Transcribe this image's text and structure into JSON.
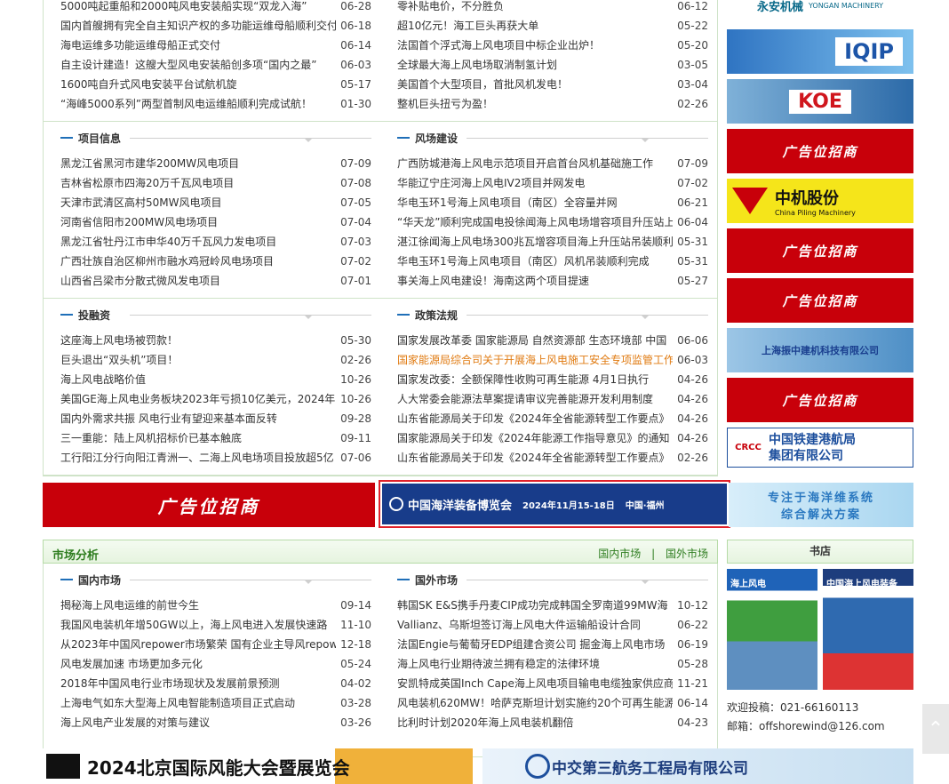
{
  "top_section": {
    "left": [
      {
        "title": "5000吨起重船和2000吨风电安装船实现“双龙入海”",
        "date": "06-28"
      },
      {
        "title": "国内首艘拥有完全自主知识产权的多功能运维母船顺利交付",
        "date": "06-18"
      },
      {
        "title": "海电运维多功能运维母船正式交付",
        "date": "06-14"
      },
      {
        "title": "自主设计建造！这艘大型风电安装船创多项“国内之最”",
        "date": "06-03"
      },
      {
        "title": "1600吨自升式风电安装平台试航机旋",
        "date": "05-17"
      },
      {
        "title": "“海峰5000系列”两型首制风电运维船顺利完成试航！",
        "date": "01-30"
      }
    ],
    "right": [
      {
        "title": "零补贴电价，不分胜负",
        "date": "06-12"
      },
      {
        "title": "超10亿元！海工巨头再获大单",
        "date": "05-22"
      },
      {
        "title": "法国首个浮式海上风电项目中标企业出炉！",
        "date": "05-20"
      },
      {
        "title": "全球最大海上风电场取消制氢计划",
        "date": "03-05"
      },
      {
        "title": "美国首个大型项目，首批风机发电！",
        "date": "03-04"
      },
      {
        "title": "整机巨头扭亏为盈！",
        "date": "02-26"
      }
    ]
  },
  "project_info": {
    "title": "项目信息",
    "items": [
      {
        "title": "黑龙江省黑河市建华200MW风电项目",
        "date": "07-09"
      },
      {
        "title": "吉林省松原市四海20万千瓦风电项目",
        "date": "07-08"
      },
      {
        "title": "天津市武清区高村50MW风电项目",
        "date": "07-05"
      },
      {
        "title": "河南省信阳市200MW风电场项目",
        "date": "07-04"
      },
      {
        "title": "黑龙江省牡丹江市申华40万千瓦风力发电项目",
        "date": "07-03"
      },
      {
        "title": "广西壮族自治区柳州市融水鸡冠岭风电场项目",
        "date": "07-02"
      },
      {
        "title": "山西省吕梁市分散式微风发电项目",
        "date": "07-01"
      }
    ]
  },
  "wind_farm": {
    "title": "风场建设",
    "items": [
      {
        "title": "广西防城港海上风电示范项目开启首台风机基础施工作",
        "date": "07-09"
      },
      {
        "title": "华能辽宁庄河海上风电IV2项目并网发电",
        "date": "07-02"
      },
      {
        "title": "华电玉环1号海上风电项目（南区）全容量并网",
        "date": "06-21"
      },
      {
        "title": "“华天龙”顺利完成国电投徐闻海上风电场增容项目升压站上",
        "date": "06-04"
      },
      {
        "title": "湛江徐闻海上风电场300兆瓦增容项目海上升压站吊装顺利",
        "date": "05-31"
      },
      {
        "title": "华电玉环1号海上风电项目（南区）风机吊装顺利完成",
        "date": "05-31"
      },
      {
        "title": "事关海上风电建设！海南这两个项目提速",
        "date": "05-27"
      }
    ]
  },
  "investment": {
    "title": "投融资",
    "items": [
      {
        "title": "这座海上风电场被罚款！",
        "date": "05-30"
      },
      {
        "title": "巨头退出“双头机”项目！",
        "date": "02-26"
      },
      {
        "title": "海上风电战略价值",
        "date": "10-26"
      },
      {
        "title": "美国GE海上风电业务板块2023年亏损10亿美元，2024年",
        "date": "10-26"
      },
      {
        "title": "国内外需求共振 风电行业有望迎来基本面反转",
        "date": "09-28"
      },
      {
        "title": "三一重能：陆上风机招标价已基本触底",
        "date": "09-11"
      },
      {
        "title": "工行阳江分行向阳江青洲一、二海上风电场项目投放超5亿",
        "date": "07-06"
      }
    ]
  },
  "policy": {
    "title": "政策法规",
    "items": [
      {
        "title": "国家发展改革委 国家能源局 自然资源部 生态环境部 中国",
        "date": "06-06",
        "highlight": false
      },
      {
        "title": "国家能源局综合司关于开展海上风电施工安全专项监管工作",
        "date": "06-03",
        "highlight": true
      },
      {
        "title": "国家发改委：全额保障性收购可再生能源 4月1日执行",
        "date": "04-26",
        "highlight": false
      },
      {
        "title": "人大常委会能源法草案提请审议完善能源开发利用制度",
        "date": "04-26",
        "highlight": false
      },
      {
        "title": "山东省能源局关于印发《2024年全省能源转型工作要点》",
        "date": "04-26",
        "highlight": false
      },
      {
        "title": "国家能源局关于印发《2024年能源工作指导意见》的通知",
        "date": "04-26",
        "highlight": false
      },
      {
        "title": "山东省能源局关于印发《2024年全省能源转型工作要点》",
        "date": "02-26",
        "highlight": false
      }
    ]
  },
  "banners": {
    "ad_wide": "广告位招商",
    "expo_name": "中国海洋装备博览会",
    "expo_date": "2024年11月15-18日",
    "expo_loc": "中国·福州",
    "ocean_ad_line1": "专注于海洋维系统",
    "ocean_ad_line2": "综合解决方案"
  },
  "market": {
    "title": "市场分析",
    "link_domestic": "国内市场",
    "sep": "|",
    "link_foreign": "国外市场",
    "domestic": {
      "title": "国内市场",
      "items": [
        {
          "title": "揭秘海上风电运维的前世今生",
          "date": "09-14"
        },
        {
          "title": "我国风电装机年增50GW以上，海上风电进入发展快速路",
          "date": "11-10"
        },
        {
          "title": "从2023年中国风repower市场繁荣 国有企业主导风repow",
          "date": "12-18"
        },
        {
          "title": "风电发展加速 市场更加多元化",
          "date": "05-24"
        },
        {
          "title": "2018年中国风电行业市场现状及发展前景预测",
          "date": "04-02"
        },
        {
          "title": "上海电气如东大型海上风电智能制造项目正式启动",
          "date": "03-28"
        },
        {
          "title": "海上风电产业发展的对策与建议",
          "date": "03-26"
        }
      ]
    },
    "foreign": {
      "title": "国外市场",
      "items": [
        {
          "title": "韩国SK E&S携手丹麦CIP成功完成韩国全罗南道99MW海",
          "date": "10-12"
        },
        {
          "title": "Vallianz、乌斯坦签订海上风电大件运输船设计合同",
          "date": "06-22"
        },
        {
          "title": "法国Engie与葡萄牙EDP组建合资公司 掘金海上风电市场",
          "date": "06-19"
        },
        {
          "title": "海上风电行业期待波兰拥有稳定的法律环境",
          "date": "05-28"
        },
        {
          "title": "安凯特成英国Inch Cape海上风电项目输电电缆独家供应商",
          "date": "11-21"
        },
        {
          "title": "风电装机620MW！哈萨克斯坦计划实施约20个可再生能源",
          "date": "06-14"
        },
        {
          "title": "比利时计划2020年海上风电装机翻倍",
          "date": "04-23"
        }
      ]
    }
  },
  "sidebar": {
    "ad_red_label": "广告位招商",
    "yongan_name": "永安机械",
    "yongan_en": "YONGAN MACHINERY",
    "iqip_text": "IQIP",
    "koe_text": "KOE",
    "piling_name": "中机股份",
    "piling_en": "China Piling Machinery",
    "zhenzhong_name": "上海振中建机科技有限公司",
    "rail_logo": "CRCC",
    "rail_name_1": "中国铁建港航局",
    "rail_name_2": "集团有限公司",
    "bookstore": "书店",
    "book1_label": "海上风电",
    "book2_label": "中国海上风电装备",
    "contact_phone_label": "欢迎投稿：",
    "contact_phone": "021-66160113",
    "contact_email_label": "邮箱：",
    "contact_email": "offshorewind@126.com"
  },
  "footer": {
    "left_ad": "2024北京国际风能大会暨展览会",
    "right_ad": "中交第三航务工程局有限公司"
  },
  "colors": {
    "accent_blue": "#1f6fb8",
    "green_header": "#2e7d1f",
    "ad_red": "#c8000a",
    "highlight_orange": "#e07a10",
    "expo_border": "#e0212a"
  }
}
